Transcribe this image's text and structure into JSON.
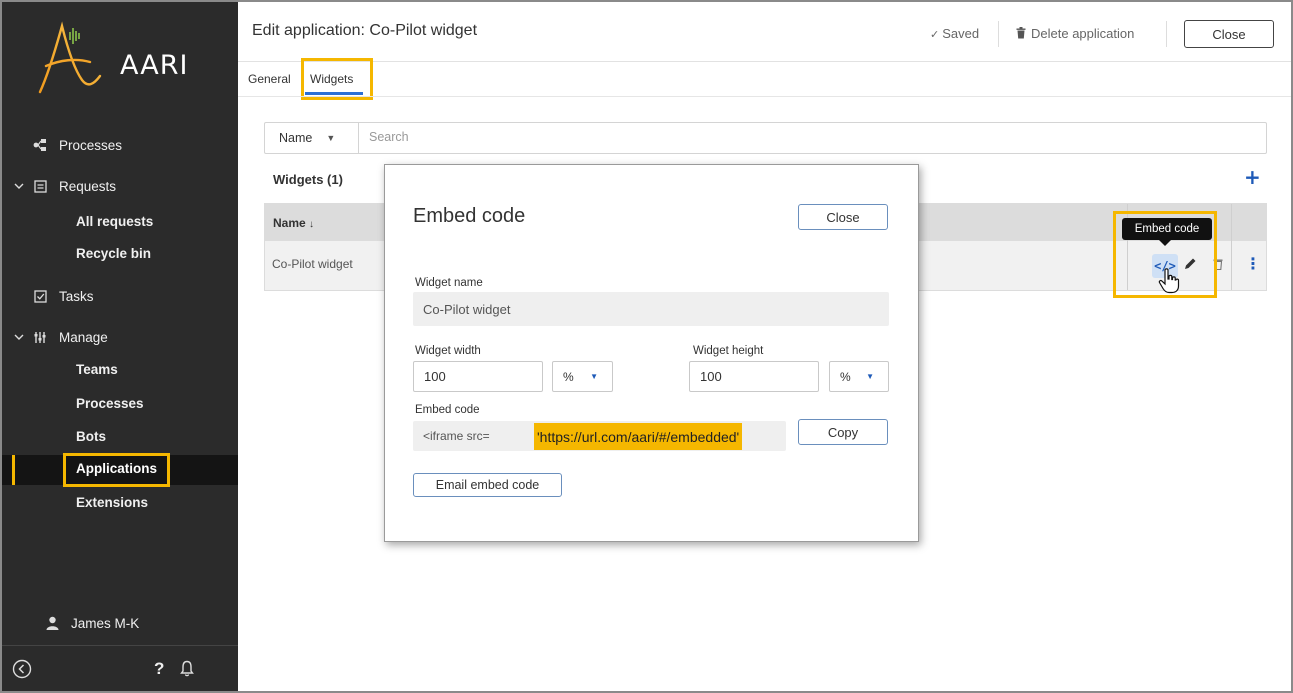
{
  "colors": {
    "sidebar_bg": "#2b2b2b",
    "accent_highlight": "#f5b700",
    "primary_blue": "#1e5ab8",
    "tooltip_bg": "#111111"
  },
  "app": {
    "logo_text": "AARI"
  },
  "sidebar": {
    "items": [
      {
        "label": "Processes",
        "icon": "processes-icon"
      },
      {
        "label": "Requests",
        "icon": "requests-icon",
        "expanded": true
      },
      {
        "label": "All requests"
      },
      {
        "label": "Recycle bin"
      },
      {
        "label": "Tasks",
        "icon": "tasks-icon"
      },
      {
        "label": "Manage",
        "icon": "manage-icon",
        "expanded": true
      },
      {
        "label": "Teams"
      },
      {
        "label": "Processes"
      },
      {
        "label": "Bots"
      },
      {
        "label": "Applications",
        "active": true
      },
      {
        "label": "Extensions"
      }
    ],
    "user": {
      "name": "James M-K",
      "icon": "user-icon"
    },
    "bottom": {
      "collapse_icon": "collapse-icon",
      "help_label": "?",
      "notifications_icon": "bell-icon"
    }
  },
  "header": {
    "title": "Edit application: Co-Pilot widget",
    "saved_label": "Saved",
    "delete_label": "Delete application",
    "close_label": "Close"
  },
  "tabs": [
    {
      "label": "General",
      "active": false
    },
    {
      "label": "Widgets",
      "active": true
    }
  ],
  "filter": {
    "field_label": "Name",
    "search_placeholder": "Search"
  },
  "widgets": {
    "title": "Widgets (1)",
    "column_name": "Name",
    "sort_indicator": "↓",
    "rows": [
      {
        "name": "Co-Pilot widget"
      }
    ],
    "tooltip": "Embed code"
  },
  "modal": {
    "title": "Embed code",
    "close_label": "Close",
    "widget_name_label": "Widget name",
    "widget_name_value": "Co-Pilot widget",
    "width_label": "Widget width",
    "width_value": "100",
    "width_unit": "%",
    "height_label": "Widget height",
    "height_value": "100",
    "height_unit": "%",
    "embed_code_label": "Embed code",
    "embed_prefix": "<iframe src=",
    "embed_url": "'https://url.com/aari/#/embedded'",
    "copy_label": "Copy",
    "email_label": "Email embed code"
  }
}
